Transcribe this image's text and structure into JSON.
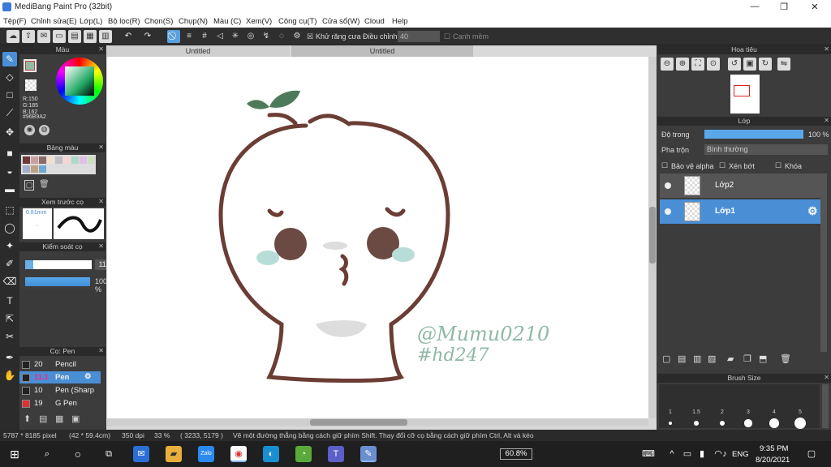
{
  "window": {
    "title": "MediBang Paint Pro (32bit)",
    "minimize": "—",
    "restore": "❐",
    "close": "✕"
  },
  "menu": [
    "Tệp(F)",
    "Chỉnh sửa(E)",
    "Lớp(L)",
    "Bộ lọc(R)",
    "Chọn(S)",
    "Chụp(N)",
    "Màu (C)",
    "Xem(V)",
    "Công cụ(T)",
    "Cửa sổ(W)",
    "Cloud",
    "Help"
  ],
  "toolbar": {
    "antialias": "Khử răng cưa",
    "correction": "Điều chỉnh",
    "correction_value": "40",
    "edge": "Cạnh mềm"
  },
  "tabs": [
    "Untitled",
    "Untitled"
  ],
  "color_panel": {
    "title": "Màu",
    "r": "R:150",
    "g": "G:185",
    "b": "B:162",
    "hex": "#96B9A2",
    "fg": "#96B9A2"
  },
  "palette_panel": {
    "title": "Bảng màu",
    "colors": [
      "#6b3a3a",
      "#c8a0a0",
      "#8c6a6a",
      "#f0e0d0",
      "#c0c0c0",
      "#f5d5d5",
      "#b0d8c8",
      "#e0c0e8",
      "#c8e0c0",
      "#a0b0c8",
      "#c0a080",
      "#70a8d0"
    ]
  },
  "preview_panel": {
    "title": "Xem trước cọ",
    "size": "0.81mm"
  },
  "control_panel": {
    "title": "Kiểm soát cọ",
    "size_value": "11.1",
    "opacity_value": "100 %"
  },
  "brush_panel": {
    "title": "Cọ: Pen",
    "items": [
      {
        "size": "20",
        "name": "Pencil",
        "color": "#222222"
      },
      {
        "size": "11.1",
        "name": "Pen",
        "color": "#222222"
      },
      {
        "size": "10",
        "name": "Pen (Sharp",
        "color": "#222222"
      },
      {
        "size": "19",
        "name": "G Pen",
        "color": "#e03030"
      }
    ]
  },
  "navigator": {
    "title": "Hoa tiêu"
  },
  "layer_panel": {
    "title": "Lớp",
    "opacity_label": "Độ trong",
    "opacity_value": "100 %",
    "opacity": 1.0,
    "blend_label": "Pha trộn",
    "blend_value": "Bình thường",
    "protect_alpha": "Bảo vệ alpha",
    "clip": "Xén bớt",
    "lock": "Khóa",
    "layers": [
      {
        "name": "Lớp2"
      },
      {
        "name": "Lớp1"
      }
    ]
  },
  "brush_size_panel": {
    "title": "Brush Size",
    "sizes": [
      "1",
      "1.5",
      "2",
      "3",
      "4",
      "5"
    ]
  },
  "status": {
    "dimensions": "5787 * 8185 pixel",
    "physical": "(42 * 59.4cm)",
    "dpi": "350 dpi",
    "zoom": "33 %",
    "coords": "( 3233, 5179 )",
    "hint": "Vẽ một đường thẳng bằng cách giữ phím Shift. Thay đổi cỡ cọ bằng cách giữ phím Ctrl, Alt và kéo"
  },
  "taskbar": {
    "battery": "60.8%",
    "lang": "ENG",
    "time": "9:35 PM",
    "date": "8/20/2021"
  },
  "signature": {
    "line1": "@Mumu0210",
    "line2": "#hd247"
  },
  "icons": {
    "brush": "brush-icon",
    "eraser": "eraser-icon",
    "undo": "undo-icon",
    "redo": "redo-icon"
  }
}
